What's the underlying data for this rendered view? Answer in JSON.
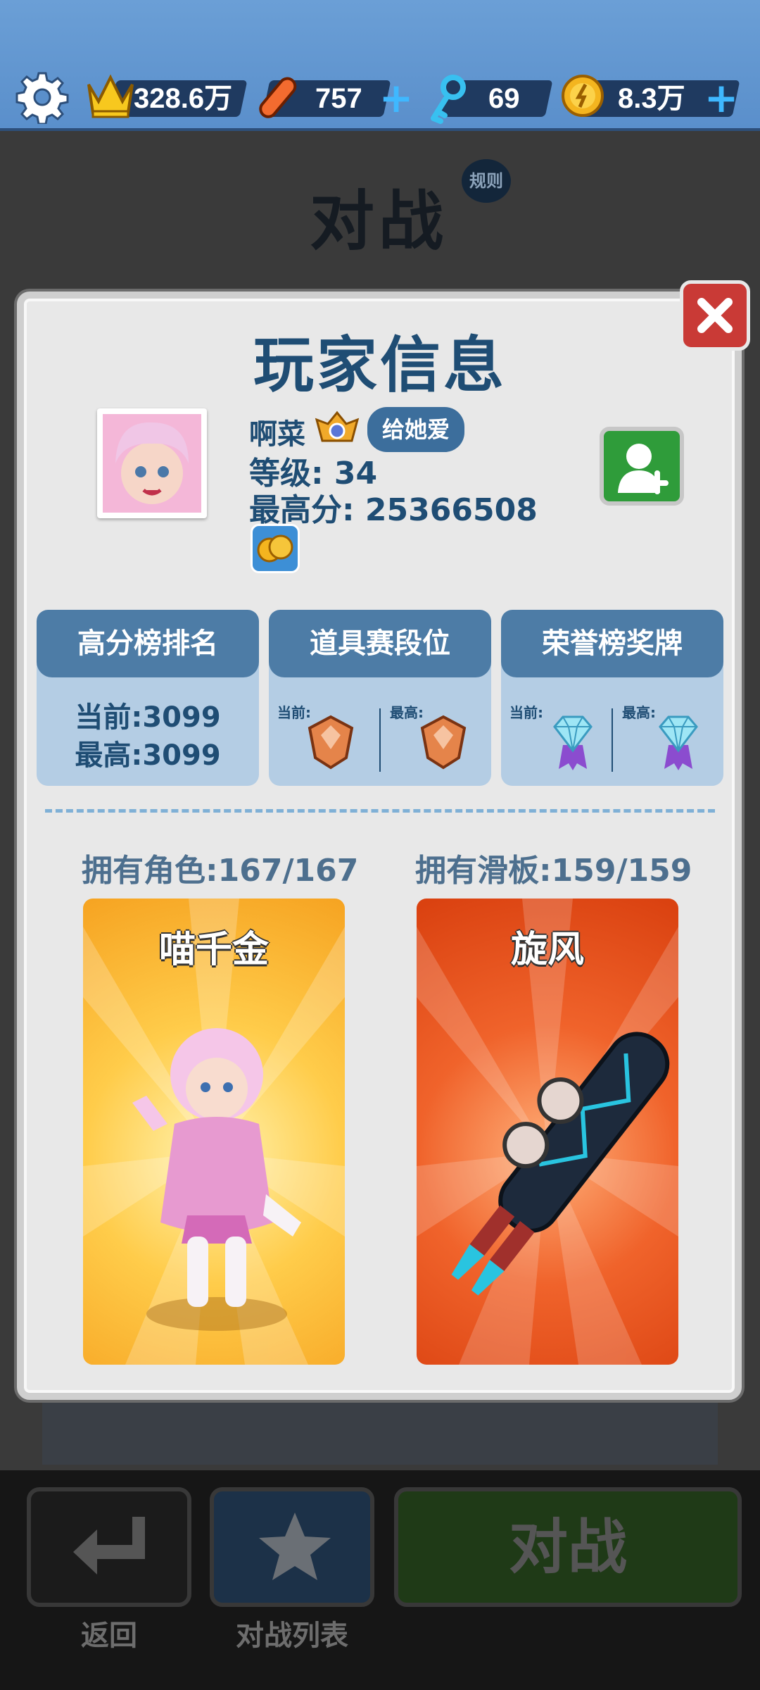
{
  "topbar": {
    "crown_value": "328.6万",
    "board_value": "757",
    "key_value": "69",
    "coin_value": "8.3万",
    "plus_label": "+"
  },
  "background": {
    "title": "对战",
    "rules_label": "规则"
  },
  "modal": {
    "title": "玩家信息",
    "close_label": "×"
  },
  "player": {
    "name": "啊菜",
    "love_button": "给她爱",
    "level": "等级: 34",
    "high_score": "最高分: 25366508"
  },
  "stats": [
    {
      "header": "高分榜排名",
      "current": "当前:3099",
      "best": "最高:3099"
    },
    {
      "header": "道具赛段位",
      "current_label": "当前:",
      "best_label": "最高:"
    },
    {
      "header": "荣誉榜奖牌",
      "current_label": "当前:",
      "best_label": "最高:"
    }
  ],
  "owned": {
    "characters_label": "拥有角色:167/167",
    "boards_label": "拥有滑板:159/159",
    "character_name": "喵千金",
    "board_name": "旋风"
  },
  "bottom": {
    "back_label": "返回",
    "battle_list_label": "对战列表",
    "battle_button": "对战"
  },
  "colors": {
    "accent_blue": "#1f4d74",
    "header_blue": "#4d7ca6",
    "close_red": "#c93a36",
    "friend_green": "#2f9c3a"
  }
}
